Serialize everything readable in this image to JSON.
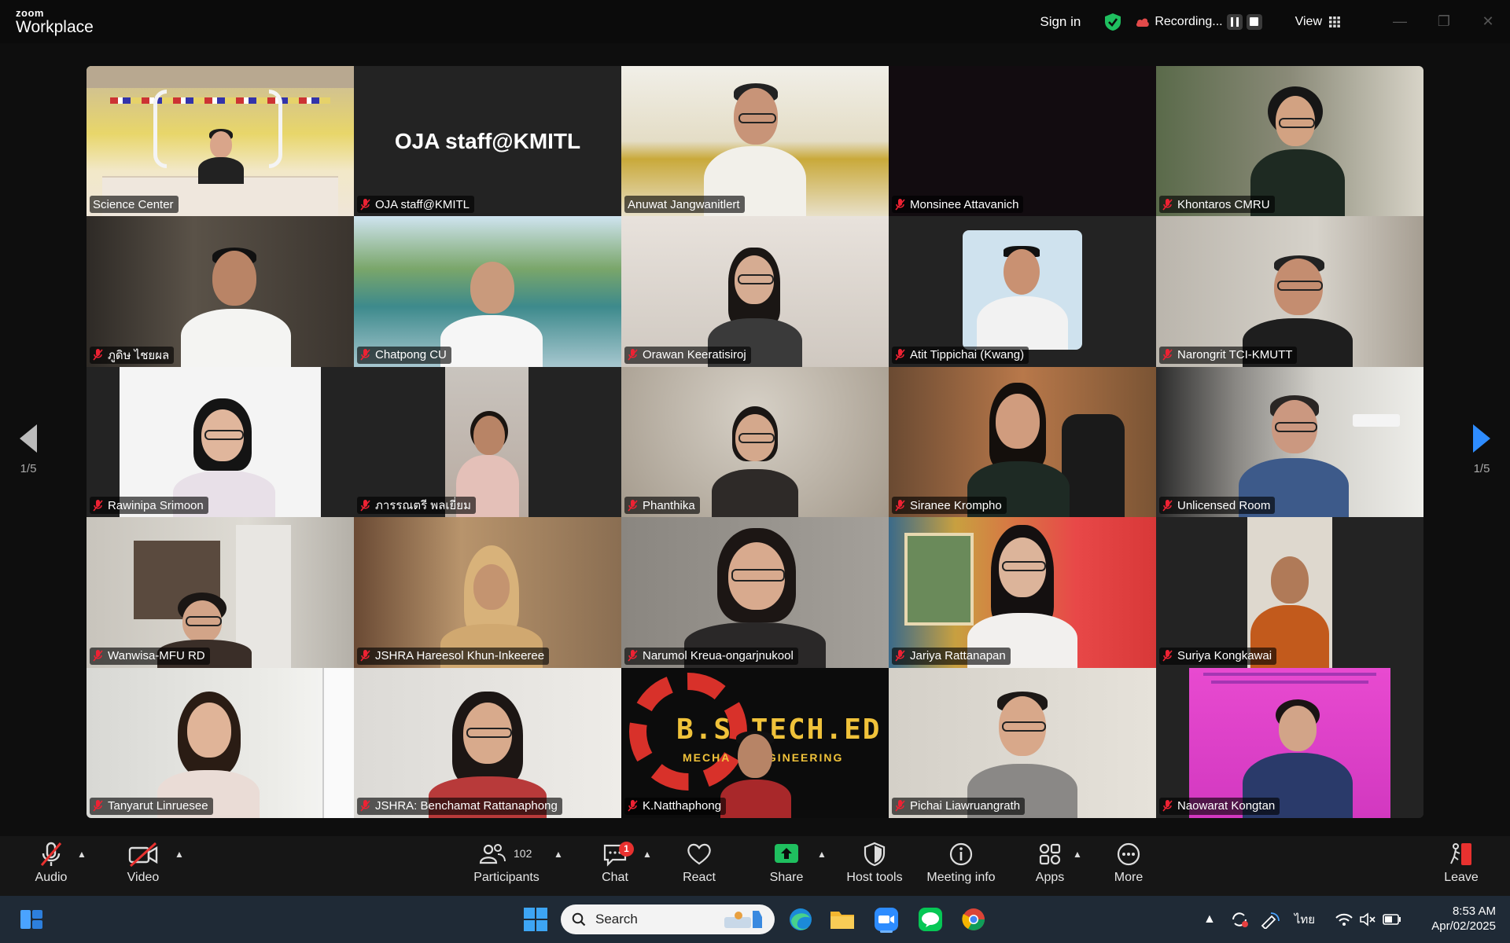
{
  "titlebar": {
    "logo_top": "zoom",
    "logo_bottom": "Workplace",
    "sign_in": "Sign in",
    "recording": "Recording...",
    "view": "View"
  },
  "gallery": {
    "page_left": "1/5",
    "page_right": "1/5",
    "tiles": [
      {
        "name": "Science Center",
        "muted": false,
        "active": true
      },
      {
        "name": "OJA staff@KMITL",
        "muted": true,
        "big": "OJA staff@KMITL"
      },
      {
        "name": "Anuwat Jangwanitlert",
        "muted": false
      },
      {
        "name": "Monsinee Attavanich",
        "muted": true
      },
      {
        "name": "Khontaros CMRU",
        "muted": true
      },
      {
        "name": "ภูดิษ ไชยผล",
        "muted": true
      },
      {
        "name": "Chatpong CU",
        "muted": true
      },
      {
        "name": "Orawan Keeratisiroj",
        "muted": true
      },
      {
        "name": "Atit Tippichai (Kwang)",
        "muted": true
      },
      {
        "name": "Narongrit TCI-KMUTT",
        "muted": true
      },
      {
        "name": "Rawinipa Srimoon",
        "muted": true
      },
      {
        "name": "ภารรณตรี พลเยี่ยม",
        "muted": true
      },
      {
        "name": "Phanthika",
        "muted": true
      },
      {
        "name": "Siranee Krompho",
        "muted": true
      },
      {
        "name": "Unlicensed Room",
        "muted": true
      },
      {
        "name": "Wanwisa-MFU RD",
        "muted": true
      },
      {
        "name": "JSHRA Hareesol Khun-Inkeeree",
        "muted": true
      },
      {
        "name": "Narumol Kreua-ongarjnukool",
        "muted": true
      },
      {
        "name": "Jariya Rattanapan",
        "muted": true
      },
      {
        "name": "Suriya Kongkawai",
        "muted": true
      },
      {
        "name": "Tanyarut Linruesee",
        "muted": true
      },
      {
        "name": "JSHRA: Benchamat Rattanaphong",
        "muted": true
      },
      {
        "name": "K.Natthaphong",
        "muted": true,
        "banner_line1": "B.S TECH.ED",
        "banner_line2": "MECHA    ENGINEERING"
      },
      {
        "name": "Pichai Liawruangrath",
        "muted": true
      },
      {
        "name": "Naowarat Kongtan",
        "muted": true
      }
    ]
  },
  "toolbar": {
    "audio": "Audio",
    "video": "Video",
    "participants": "Participants",
    "participants_count": "102",
    "chat": "Chat",
    "chat_badge": "1",
    "react": "React",
    "share": "Share",
    "host_tools": "Host tools",
    "meeting_info": "Meeting info",
    "apps": "Apps",
    "more": "More",
    "leave": "Leave"
  },
  "taskbar": {
    "search": "Search",
    "lang": "ไทย",
    "time": "8:53 AM",
    "date": "Apr/02/2025"
  }
}
